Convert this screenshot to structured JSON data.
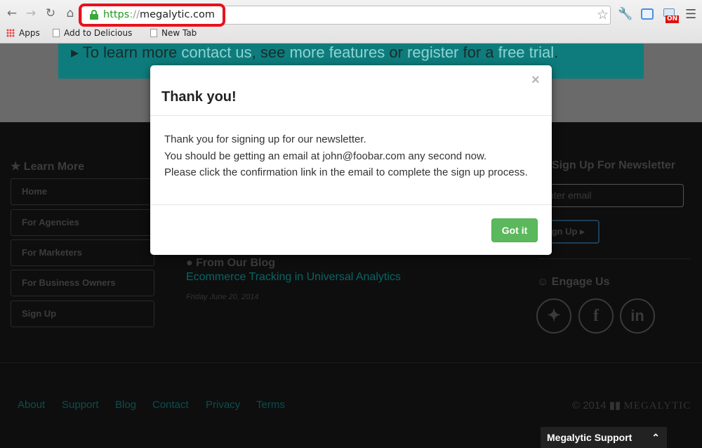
{
  "browser": {
    "url_scheme": "https",
    "url_separator": "://",
    "url_host": "megalytic.com",
    "bookmarks": [
      "Apps",
      "Add to Delicious",
      "New Tab"
    ],
    "highlight_color": "#e8121b",
    "extension_badge": "ON",
    "icons": [
      "back-arrow-icon",
      "forward-arrow-icon",
      "reload-icon",
      "home-icon",
      "lock-icon",
      "star-icon",
      "wrench-icon",
      "extension-icon",
      "menu-icon"
    ]
  },
  "page": {
    "banner": {
      "prefix": "To learn more ",
      "contact": "contact us",
      "mid1": ", see ",
      "features": "more features",
      "mid2": " or ",
      "register": "register",
      "mid3": " for a ",
      "trial": "free trial",
      "suffix": "."
    },
    "learn_more": {
      "title": "Learn More",
      "items": [
        "Home",
        "For Agencies",
        "For Marketers",
        "For Business Owners",
        "Sign Up"
      ]
    },
    "blog": {
      "title": "From Our Blog",
      "post_title": "Ecommerce Tracking in Universal Analytics",
      "post_date": "Friday June 20, 2014"
    },
    "newsletter": {
      "title": "Sign Up For Newsletter",
      "email_placeholder": "nter email",
      "button_label": "ign Up"
    },
    "engage": {
      "title": "Engage Us"
    },
    "footer": {
      "links": [
        "About",
        "Support",
        "Blog",
        "Contact",
        "Privacy",
        "Terms"
      ],
      "copyright": "© 2014",
      "brand": "MEGALYTIC"
    },
    "support_tab": "Megalytic Support"
  },
  "modal": {
    "title": "Thank you!",
    "close": "×",
    "lines": [
      "Thank you for signing up for our newsletter.",
      "You should be getting an email at john@foobar.com any second now.",
      "Please click the confirmation link in the email to complete the sign up process."
    ],
    "button": "Got it",
    "button_color": "#5cb85c"
  }
}
